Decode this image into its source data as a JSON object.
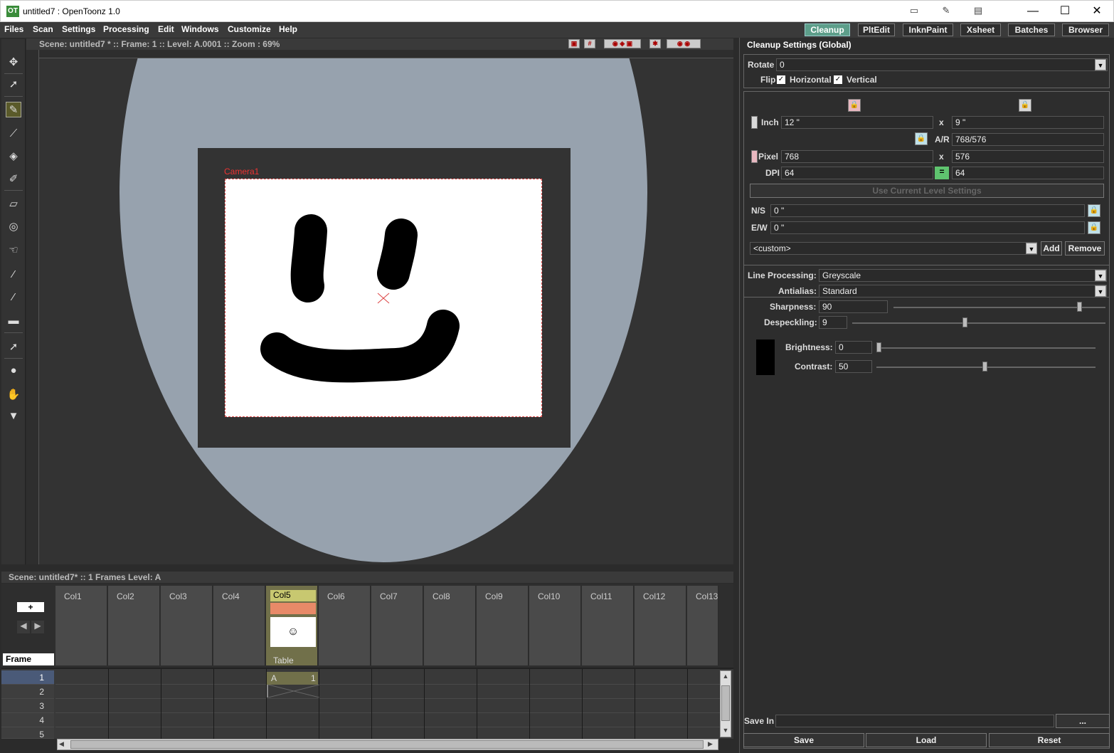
{
  "window": {
    "title": "untitled7 : OpenToonz 1.0",
    "app_icon": "OT"
  },
  "menu": [
    "Files",
    "Scan",
    "Settings",
    "Processing",
    "Edit",
    "Windows",
    "Customize",
    "Help"
  ],
  "rooms": [
    "Cleanup",
    "PltEdit",
    "InknPaint",
    "Xsheet",
    "Batches",
    "Browser"
  ],
  "active_room": "Cleanup",
  "viewer": {
    "status": "Scene: untitled7 *   ::   Frame: 1   ::   Level: A.0001   ::   Zoom : 69%",
    "camera_label": "Camera1"
  },
  "xsheet": {
    "status": "Scene: untitled7*   ::   1 Frames  Level: A",
    "columns": [
      "Col1",
      "Col2",
      "Col3",
      "Col4",
      "Col5",
      "Col6",
      "Col7",
      "Col8",
      "Col9",
      "Col10",
      "Col11",
      "Col12",
      "Col13"
    ],
    "col5_pegbar": "Table",
    "frame_label": "Frame",
    "rows": [
      "1",
      "2",
      "3",
      "4",
      "5"
    ],
    "cell_level": "A",
    "cell_frame": "1"
  },
  "cleanup": {
    "title": "Cleanup Settings (Global)",
    "rotate_label": "Rotate",
    "rotate_value": "0",
    "flip_label": "Flip",
    "horizontal_label": "Horizontal",
    "vertical_label": "Vertical",
    "inch_label": "Inch",
    "inch_w": "12 \"",
    "inch_h": "9 \"",
    "x_label": "x",
    "ar_label": "A/R",
    "ar_value": "768/576",
    "pixel_label": "Pixel",
    "pixel_w": "768",
    "pixel_h": "576",
    "dpi_label": "DPI",
    "dpi_x": "64",
    "dpi_y": "64",
    "use_current_label": "Use Current Level Settings",
    "ns_label": "N/S",
    "ns_value": "0 \"",
    "ew_label": "E/W",
    "ew_value": "0 \"",
    "preset_value": "<custom>",
    "add_label": "Add",
    "remove_label": "Remove",
    "line_processing_label": "Line Processing:",
    "line_processing_value": "Greyscale",
    "antialias_label": "Antialias:",
    "antialias_value": "Standard",
    "sharpness_label": "Sharpness:",
    "sharpness_value": "90",
    "despeckling_label": "Despeckling:",
    "despeckling_value": "9",
    "brightness_label": "Brightness:",
    "brightness_value": "0",
    "contrast_label": "Contrast:",
    "contrast_value": "50",
    "save_in_label": "Save In",
    "browse_label": "...",
    "save_label": "Save",
    "load_label": "Load",
    "reset_label": "Reset"
  }
}
